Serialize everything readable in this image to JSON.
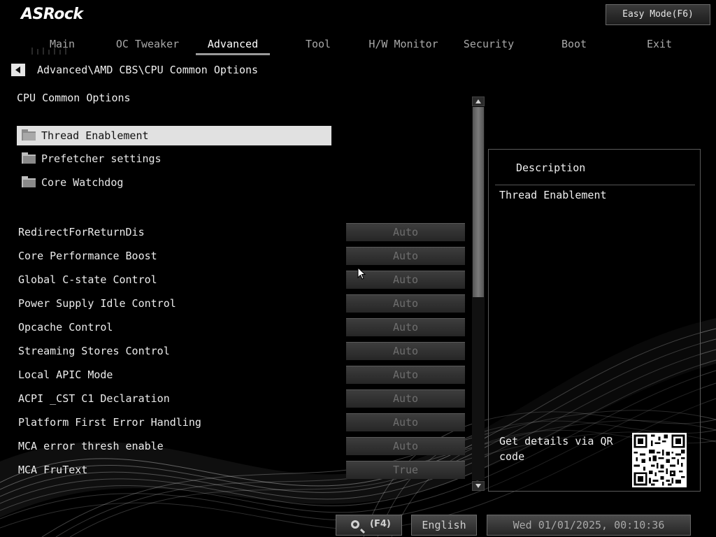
{
  "header": {
    "logo": "ASRock",
    "easy_mode_label": "Easy Mode(F6)"
  },
  "tabs": [
    {
      "label": "Main"
    },
    {
      "label": "OC Tweaker"
    },
    {
      "label": "Advanced",
      "active": true
    },
    {
      "label": "Tool"
    },
    {
      "label": "H/W Monitor"
    },
    {
      "label": "Security"
    },
    {
      "label": "Boot"
    },
    {
      "label": "Exit"
    }
  ],
  "breadcrumb": "Advanced\\AMD CBS\\CPU Common Options",
  "section_title": "CPU Common Options",
  "submenus": [
    {
      "label": "Thread Enablement",
      "selected": true
    },
    {
      "label": "Prefetcher settings"
    },
    {
      "label": "Core Watchdog"
    }
  ],
  "settings": [
    {
      "label": "RedirectForReturnDis",
      "value": "Auto"
    },
    {
      "label": "Core Performance Boost",
      "value": "Auto"
    },
    {
      "label": "Global C-state Control",
      "value": "Auto"
    },
    {
      "label": "Power Supply Idle Control",
      "value": "Auto"
    },
    {
      "label": "Opcache Control",
      "value": "Auto"
    },
    {
      "label": "Streaming Stores Control",
      "value": "Auto"
    },
    {
      "label": "Local APIC Mode",
      "value": "Auto"
    },
    {
      "label": "ACPI _CST C1 Declaration",
      "value": "Auto"
    },
    {
      "label": "Platform First Error Handling",
      "value": "Auto"
    },
    {
      "label": "MCA error thresh enable",
      "value": "Auto"
    },
    {
      "label": "MCA FruText",
      "value": "True"
    }
  ],
  "description": {
    "title": "Description",
    "text": "Thread Enablement",
    "qr_text": "Get details via QR code"
  },
  "bottom": {
    "search_key": "(F4)",
    "language": "English",
    "datetime": "Wed 01/01/2025, 00:10:36"
  },
  "colors": {
    "background": "#000000",
    "selected_row": "#e1e1e1",
    "disabled_value_text": "#6e6e6e"
  }
}
